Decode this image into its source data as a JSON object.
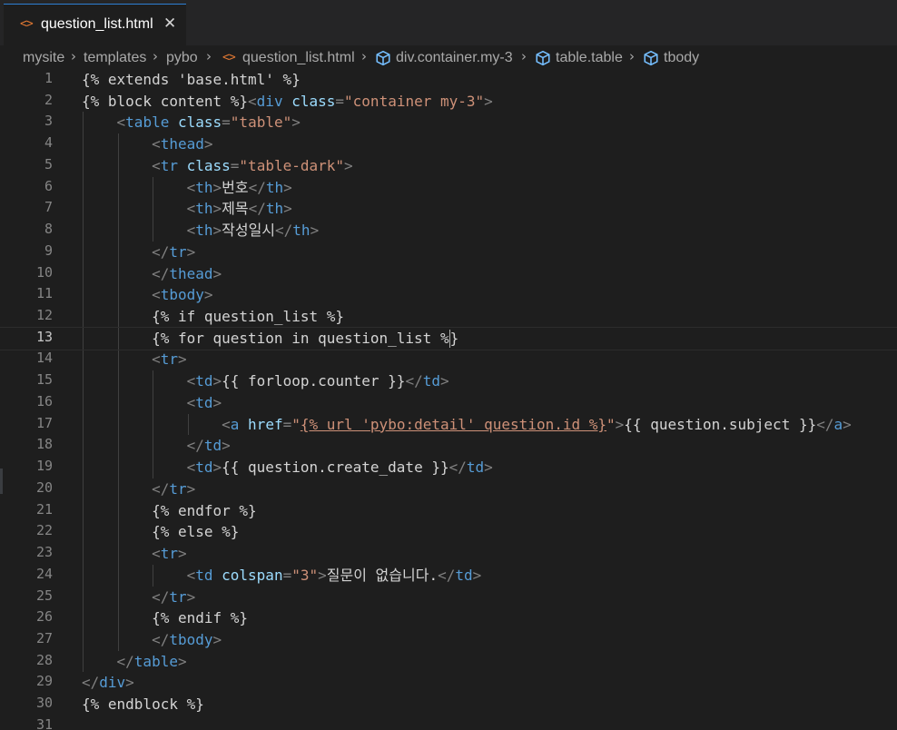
{
  "tab": {
    "icon": "html-file-icon",
    "label": "question_list.html",
    "close_glyph": "✕"
  },
  "breadcrumb": [
    {
      "label": "mysite",
      "icon": ""
    },
    {
      "label": "templates",
      "icon": ""
    },
    {
      "label": "pybo",
      "icon": ""
    },
    {
      "label": "question_list.html",
      "icon": "html-file-icon"
    },
    {
      "label": "div.container.my-3",
      "icon": "element-cube-icon"
    },
    {
      "label": "table.table",
      "icon": "element-cube-icon"
    },
    {
      "label": "tbody",
      "icon": "element-cube-icon"
    }
  ],
  "editor": {
    "active_line": 13,
    "line_numbers": [
      "1",
      "2",
      "3",
      "4",
      "5",
      "6",
      "7",
      "8",
      "9",
      "10",
      "11",
      "12",
      "13",
      "14",
      "15",
      "16",
      "17",
      "18",
      "19",
      "20",
      "21",
      "22",
      "23",
      "24",
      "25",
      "26",
      "27",
      "28",
      "29",
      "30",
      "31"
    ],
    "lines": [
      "{% extends 'base.html' %}",
      "{% block content %}<div class=\"container my-3\">",
      "    <table class=\"table\">",
      "        <thead>",
      "        <tr class=\"table-dark\">",
      "            <th>번호</th>",
      "            <th>제목</th>",
      "            <th>작성일시</th>",
      "        </tr>",
      "        </thead>",
      "        <tbody>",
      "        {% if question_list %}",
      "        {% for question in question_list %}",
      "        <tr>",
      "            <td>{{ forloop.counter }}</td>",
      "            <td>",
      "                <a href=\"{% url 'pybo:detail' question.id %}\">{{ question.subject }}</a>",
      "            </td>",
      "            <td>{{ question.create_date }}</td>",
      "        </tr>",
      "        {% endfor %}",
      "        {% else %}",
      "        <tr>",
      "            <td colspan=\"3\">질문이 없습니다.</td>",
      "        </tr>",
      "        {% endif %}",
      "        </tbody>",
      "    </table>",
      "</div>",
      "{% endblock %}",
      ""
    ]
  },
  "colors": {
    "background": "#1e1e1e",
    "tag": "#569cd6",
    "bracket": "#808080",
    "attribute": "#9cdcfe",
    "string": "#ce9178",
    "text": "#d4d4d4",
    "line_number": "#858585",
    "html_icon": "#e37933",
    "cube_icon": "#75beff"
  }
}
